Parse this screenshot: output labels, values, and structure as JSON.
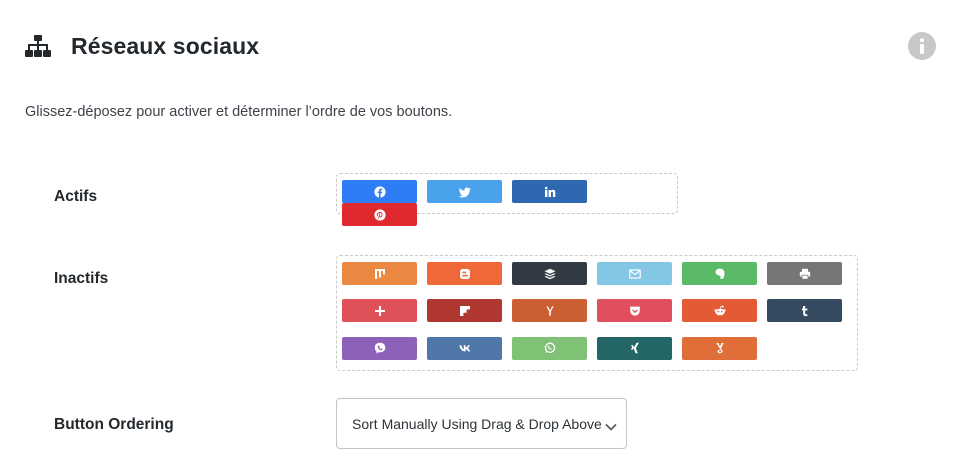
{
  "header": {
    "title": "Réseaux sociaux",
    "icon": "sitemap-icon",
    "info_icon": "info-icon"
  },
  "description": "Glissez-déposez pour activer et déterminer l’ordre de vos boutons.",
  "active": {
    "label": "Actifs",
    "buttons": [
      {
        "name": "facebook",
        "icon": "facebook-icon",
        "color": "#2e7cf6"
      },
      {
        "name": "twitter",
        "icon": "twitter-icon",
        "color": "#4aa1ec"
      },
      {
        "name": "linkedin",
        "icon": "linkedin-icon",
        "color": "#2d68b0"
      },
      {
        "name": "pinterest",
        "icon": "pinterest-icon",
        "color": "#e0282f"
      }
    ]
  },
  "inactive": {
    "label": "Inactifs",
    "buttons": [
      {
        "name": "mix",
        "icon": "mix-icon",
        "color": "#eb8841"
      },
      {
        "name": "blogger",
        "icon": "blogger-icon",
        "color": "#f0673a"
      },
      {
        "name": "buffer",
        "icon": "buffer-icon",
        "color": "#323b43"
      },
      {
        "name": "email",
        "icon": "email-icon",
        "color": "#84c7e4"
      },
      {
        "name": "evernote",
        "icon": "evernote-icon",
        "color": "#5bba67"
      },
      {
        "name": "print",
        "icon": "print-icon",
        "color": "#767676"
      },
      {
        "name": "google-plus",
        "icon": "plus-icon",
        "color": "#df5158"
      },
      {
        "name": "flipboard",
        "icon": "flipboard-icon",
        "color": "#b13731"
      },
      {
        "name": "hacker-news",
        "icon": "y-combinator-icon",
        "color": "#cc5e34"
      },
      {
        "name": "pocket",
        "icon": "pocket-icon",
        "color": "#e14e5d"
      },
      {
        "name": "reddit",
        "icon": "reddit-icon",
        "color": "#e35a35"
      },
      {
        "name": "tumblr",
        "icon": "tumblr-icon",
        "color": "#364a5f"
      },
      {
        "name": "viber",
        "icon": "viber-icon",
        "color": "#8e61b9"
      },
      {
        "name": "vk",
        "icon": "vk-icon",
        "color": "#4f77a8"
      },
      {
        "name": "whatsapp",
        "icon": "whatsapp-icon",
        "color": "#7fc276"
      },
      {
        "name": "xing",
        "icon": "xing-icon",
        "color": "#246565"
      },
      {
        "name": "yummly",
        "icon": "yummly-icon",
        "color": "#df6e38"
      }
    ]
  },
  "ordering": {
    "label": "Button Ordering",
    "selected": "Sort Manually Using Drag & Drop Above",
    "icon": "chevron-down-icon"
  }
}
